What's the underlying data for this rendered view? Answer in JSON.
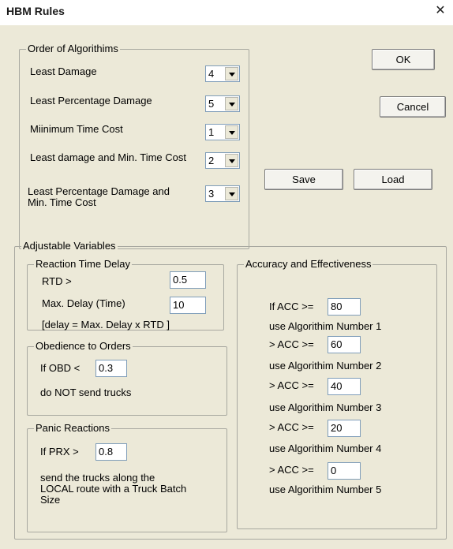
{
  "window": {
    "title": "HBM Rules",
    "close_glyph": "✕"
  },
  "order_group": {
    "legend": "Order of Algorithims",
    "items": [
      {
        "label": "Least Damage",
        "value": "4"
      },
      {
        "label": "Least Percentage Damage",
        "value": "5"
      },
      {
        "label": "Miinimum Time Cost",
        "value": "1"
      },
      {
        "label": "Least damage and Min. Time Cost",
        "value": "2"
      },
      {
        "label": "Least Percentage Damage and Min. Time Cost",
        "value": "3"
      }
    ]
  },
  "buttons": {
    "ok": "OK",
    "cancel": "Cancel",
    "save": "Save",
    "load": "Load"
  },
  "adjustable": {
    "legend": "Adjustable Variables",
    "reaction": {
      "legend": "Reaction Time Delay",
      "rtd_label": "RTD >",
      "rtd_value": "0.5",
      "max_delay_label": "Max. Delay (Time)",
      "max_delay_value": "10",
      "formula": "[delay = Max. Delay x RTD ]"
    },
    "obedience": {
      "legend": "Obedience to Orders",
      "obd_label": "If OBD <",
      "obd_value": "0.3",
      "note": "do NOT send trucks"
    },
    "panic": {
      "legend": "Panic Reactions",
      "prx_label": "If PRX >",
      "prx_value": "0.8",
      "note": "send the trucks along the LOCAL route with a Truck Batch Size"
    },
    "accuracy": {
      "legend": "Accuracy and Effectiveness",
      "rows": [
        {
          "cond": "If ACC >=",
          "value": "80",
          "use": "use Algorithim Number 1"
        },
        {
          "cond": "> ACC >=",
          "value": "60",
          "use": "use Algorithim Number 2"
        },
        {
          "cond": "> ACC >=",
          "value": "40",
          "use": "use Algorithim Number 3"
        },
        {
          "cond": "> ACC >=",
          "value": "20",
          "use": "use Algorithim Number 4"
        },
        {
          "cond": "> ACC >=",
          "value": "0",
          "use": "use Algorithim Number 5"
        }
      ]
    }
  }
}
